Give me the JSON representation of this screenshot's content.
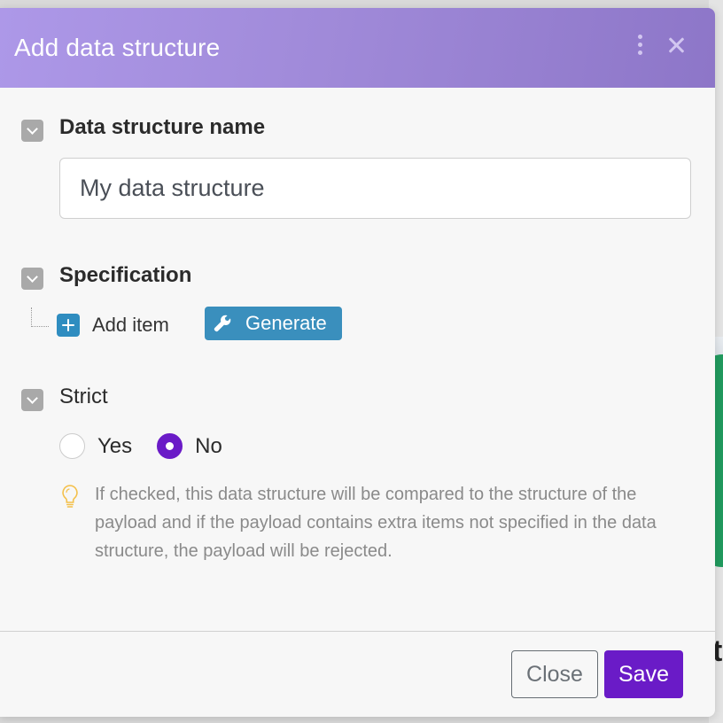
{
  "modal": {
    "title": "Add data structure",
    "menu_icon": "kebab-vertical-icon",
    "close_icon": "close-icon"
  },
  "name_section": {
    "label": "Data structure name",
    "input_value": "My data structure"
  },
  "specification_section": {
    "label": "Specification",
    "add_item_label": "Add item",
    "generate_label": "Generate",
    "generate_icon": "wrench-icon"
  },
  "strict_section": {
    "label": "Strict",
    "options": [
      {
        "label": "Yes",
        "checked": false
      },
      {
        "label": "No",
        "checked": true
      }
    ],
    "hint_icon": "lightbulb-icon",
    "hint": "If checked, this data structure will be compared to the structure of the payload and if the payload contains extra items not specified in the data structure, the payload will be rejected."
  },
  "footer": {
    "close_label": "Close",
    "save_label": "Save"
  },
  "background": {
    "partial_letter": "t"
  },
  "colors": {
    "header_gradient_start": "#ad98e8",
    "header_gradient_end": "#8d76c8",
    "primary": "#6a1bc7",
    "generate_blue": "#3a8fbd",
    "hint_bulb": "#f4c04a"
  }
}
